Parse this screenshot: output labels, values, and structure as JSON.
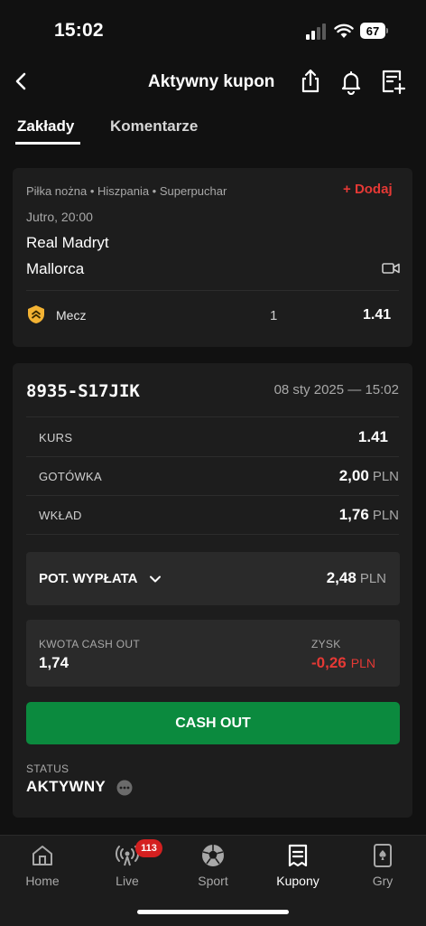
{
  "status_bar": {
    "time": "15:02",
    "battery": "67"
  },
  "header": {
    "title": "Aktywny kupon"
  },
  "tabs": [
    {
      "label": "Zakłady",
      "active": true
    },
    {
      "label": "Komentarze",
      "active": false
    }
  ],
  "event": {
    "league": "Piłka nożna • Hiszpania • Superpuchar",
    "add_label": "Dodaj",
    "datetime": "Jutro, 20:00",
    "team_home": "Real Madryt",
    "team_away": "Mallorca",
    "market": "Mecz",
    "selection": "1",
    "odds": "1.41"
  },
  "coupon": {
    "id": "8935-S17JIK",
    "date": "08 sty 2025 — 15:02",
    "rows": [
      {
        "label": "KURS",
        "value": "1.41",
        "unit": ""
      },
      {
        "label": "GOTÓWKA",
        "value": "2,00",
        "unit": "PLN"
      },
      {
        "label": "WKŁAD",
        "value": "1,76",
        "unit": "PLN"
      }
    ],
    "payout_label": "POT. WYPŁATA",
    "payout_value": "2,48",
    "payout_unit": "PLN",
    "cashout_amount_label": "KWOTA CASH OUT",
    "cashout_amount": "1,74",
    "profit_label": "ZYSK",
    "profit_value": "-0,26",
    "profit_unit": "PLN",
    "cashout_button": "CASH OUT",
    "status_label": "STATUS",
    "status_value": "AKTYWNY"
  },
  "nav": {
    "items": [
      {
        "label": "Home",
        "icon": "home-icon"
      },
      {
        "label": "Live",
        "icon": "live-icon"
      },
      {
        "label": "Sport",
        "icon": "soccer-ball-icon"
      },
      {
        "label": "Kupony",
        "icon": "coupon-icon"
      },
      {
        "label": "Gry",
        "icon": "cards-icon"
      }
    ],
    "live_badge": "113"
  },
  "colors": {
    "accent_red": "#e53935",
    "cashout_green": "#0b8a3e",
    "background": "#111111",
    "card": "#1d1d1d"
  }
}
